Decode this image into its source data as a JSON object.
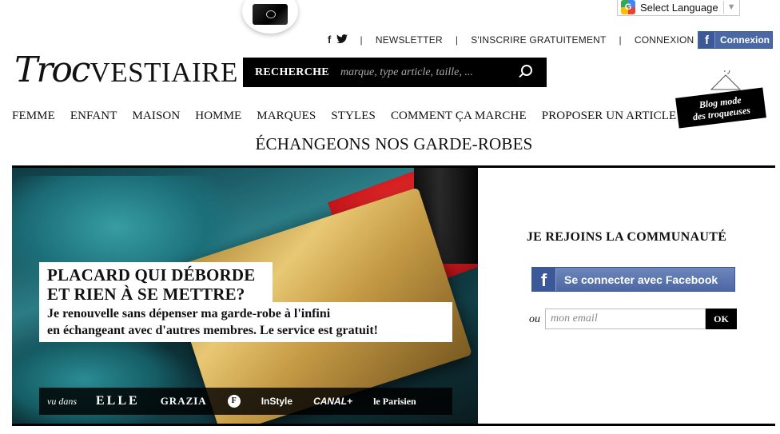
{
  "translate": {
    "label": "Select Language",
    "arrow": "▼",
    "logo_letter": "G"
  },
  "top_links": {
    "facebook": "f",
    "twitter": "🐦",
    "separator": "|",
    "newsletter": "NEWSLETTER",
    "signup": "S'INSCRIRE GRATUITEMENT",
    "login": "CONNEXION"
  },
  "fb_connexion": {
    "icon": "f",
    "label": "Connexion"
  },
  "logo": {
    "part1": "Troc",
    "part2": "VESTIAIRE"
  },
  "search": {
    "label": "RECHERCHE",
    "placeholder": "marque, type article, taille, ..."
  },
  "blog_badge": {
    "line1": "Blog mode",
    "line2": "des troqueuses"
  },
  "nav": {
    "items": [
      "FEMME",
      "ENFANT",
      "MAISON",
      "HOMME",
      "MARQUES",
      "STYLES",
      "COMMENT ÇA MARCHE",
      "PROPOSER UN ARTICLE"
    ]
  },
  "tagline": "ÉCHANGEONS NOS GARDE-ROBES",
  "hero": {
    "headline_1": "PLACARD QUI DÉBORDE",
    "headline_2": "ET RIEN À SE METTRE?",
    "subline_1": "Je renouvelle sans dépenser ma garde-robe à l'infini",
    "subline_2": "en échangeant avec d'autres membres. Le service est gratuit!",
    "press": {
      "label": "vu dans",
      "logos": [
        "ELLE",
        "GRAZIA",
        "F",
        "InStyle",
        "CANAL+",
        "le Parisien"
      ]
    }
  },
  "join": {
    "title": "JE REJOINS LA COMMUNAUTÉ",
    "fb_icon": "f",
    "fb_button": "Se connecter avec Facebook",
    "or": "ou",
    "email_placeholder": "mon email",
    "ok": "OK"
  },
  "colors": {
    "facebook_blue": "#3b5998",
    "black": "#000000"
  }
}
